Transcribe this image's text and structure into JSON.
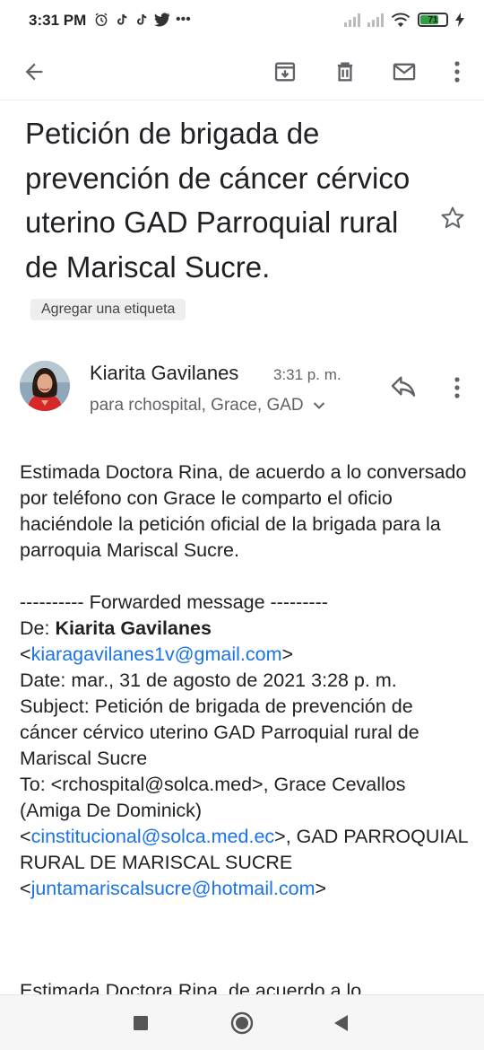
{
  "status_bar": {
    "time": "3:31 PM",
    "notification_icons": [
      "alarm-icon",
      "tiktok-icon",
      "tiktok-icon",
      "twitter-icon",
      "more-dots"
    ],
    "battery": "71",
    "battery_level": 0.71
  },
  "toolbar": {
    "icons": [
      "back-arrow-icon",
      "archive-icon",
      "delete-icon",
      "mark-unread-icon",
      "more-vert-icon"
    ]
  },
  "subject": {
    "text": "Petición de brigada de prevención de cáncer cérvico uterino GAD Parroquial rural de Mariscal Sucre.",
    "label_chip": "Agregar una etiqueta"
  },
  "sender": {
    "name": "Kiarita Gavilanes",
    "time": "3:31 p. m.",
    "recipients": "para rchospital, Grace, GAD"
  },
  "body": {
    "intro": "Estimada Doctora Rina, de acuerdo a lo conversado por teléfono con Grace le comparto el oficio haciéndole la petición oficial de la brigada para la parroquia Mariscal Sucre.",
    "forward_header": "---------- Forwarded message ---------",
    "from_label": "De:",
    "from_name": "Kiarita Gavilanes",
    "from_email": "kiaragavilanes1v@gmail.com",
    "date_line": "Date: mar., 31 de agosto de 2021 3:28 p. m.",
    "subject_line": "Subject: Petición de brigada de prevención de cáncer cérvico uterino GAD Parroquial rural de Mariscal Sucre",
    "to_prefix": "To: <rchospital@solca.med>, Grace Cevallos (Amiga De Dominick)",
    "to_email_1": "cinstitucional@solca.med.ec",
    "to_mid": ", GAD PARROQUIAL RURAL DE MARISCAL SUCRE",
    "to_email_2": "juntamariscalsucre@hotmail.com",
    "cutoff_text": "Estimada Doctora Rina, de acuerdo a lo"
  },
  "colors": {
    "link": "#1a73e8",
    "text": "#202124",
    "secondary": "#5f6368",
    "battery_green": "#2ea043"
  }
}
